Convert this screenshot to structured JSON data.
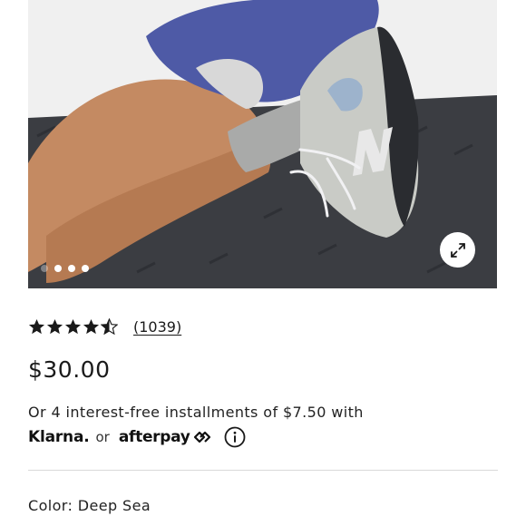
{
  "gallery": {
    "image_alt": "",
    "dots_total": 4,
    "active_dot": 1,
    "expand_icon": "expand-arrows-icon"
  },
  "product": {
    "rating_value": 4.5,
    "rating_max": 5,
    "review_count": "(1039)",
    "price": "$30.00",
    "installments_text": "Or 4 interest-free installments of $7.50 with",
    "klarna_label": "Klarna.",
    "or_label": "or",
    "afterpay_label": "afterpay",
    "info_icon": "info-icon",
    "color_label": "Color:",
    "color_value": "Deep Sea"
  },
  "colors": {
    "text": "#1a1a1a",
    "divider": "#d9d9d9",
    "star": "#1a1a1a"
  }
}
